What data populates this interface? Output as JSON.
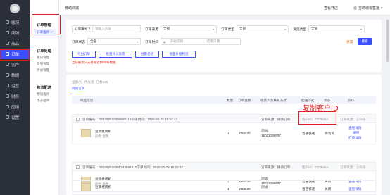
{
  "sidebar": {
    "items": [
      {
        "label": "概况"
      },
      {
        "label": "店铺"
      },
      {
        "label": "商品"
      },
      {
        "label": "订单"
      },
      {
        "label": "客户"
      },
      {
        "label": "数据"
      },
      {
        "label": "运营"
      },
      {
        "label": "财务"
      },
      {
        "label": "应用"
      },
      {
        "label": "设置"
      }
    ],
    "active_index": 3
  },
  "subnav": {
    "sections": [
      {
        "title": "订单管理",
        "items": [
          "订单查询 ✓"
        ]
      },
      {
        "title": "订单处理",
        "items": [
          "发货管理",
          "售后管理",
          "评价管理"
        ]
      },
      {
        "title": "物流配送",
        "items": [
          "物流查询",
          "电子面单"
        ]
      }
    ]
  },
  "header": {
    "title": "移动商城",
    "right1": "查看开店",
    "right2": "吉蹄城零售批"
  },
  "filters": {
    "order_no_label": "订单编号",
    "order_no_arrow": "▾",
    "order_no_placeholder": "请输入内容",
    "source_label": "订单来源",
    "source_value": "全部",
    "type_label": "订单类型",
    "type_value": "全部",
    "ship_label": "发货类型",
    "ship_value": "全部",
    "status_label": "订单状态",
    "status_value": "全部",
    "time_label": "订单时间",
    "time_start": "开始日期",
    "time_sep": "-",
    "time_end": "结束日期",
    "reset": "重置",
    "search": "搜索",
    "buttons": [
      "导出订单",
      "批量导入发货",
      "批量发货",
      "批量补偿物流"
    ],
    "warning": "当前展示只支持最近1000条数据"
  },
  "list": {
    "tabs": [
      "全部(?)",
      "待发货",
      "已售125"
    ],
    "subtab": "商城订单",
    "columns": [
      "商品信息",
      "数量",
      "订单金额",
      "收货人及联系方式",
      "配送方式",
      "状态",
      "操作"
    ],
    "orders": [
      {
        "header": "订单编号：D33392510300580110下单时间：2020-02-26 15:52:43",
        "source": "订单来源：微商订单",
        "customer": "客户ID：D339684",
        "channel": "订单来源：公众号",
        "product": "豆浆煮粥机",
        "spec": "颜色:混色",
        "qty": "1",
        "amount": "¥382.00",
        "receiver": "测试",
        "phone": "15011099907",
        "ship": "普通快递",
        "status": "待发货",
        "ops": [
          "查看详情",
          "发货",
          "打单详情"
        ]
      },
      {
        "header": "订单编号：D33392510305743652610下单时间：2020-02-26 15:52:27",
        "source": "订单来源：微商订单",
        "customer": "客户ID：D339684",
        "channel": "订单来源：公众号",
        "product": "豆浆煮粥机",
        "spec": "颜色:混色",
        "qty": "1",
        "amount": "¥382.00",
        "receiver": "测试",
        "phone": "15011099907",
        "ship": "普通快递",
        "status": "关闭",
        "ops": [
          "查看详情"
        ]
      },
      {
        "product": "豆浆煮粥机",
        "qty": "1",
        "amount": "¥382.00",
        "receiver": "测试",
        "ship": "普通快递",
        "status": "关闭",
        "ops": [
          "查看详情"
        ]
      }
    ]
  },
  "annotation": "复制客户ID",
  "colors": {
    "accent": "#3b4fff",
    "highlight": "#e0201e",
    "sidebar": "#2b2f3a"
  }
}
